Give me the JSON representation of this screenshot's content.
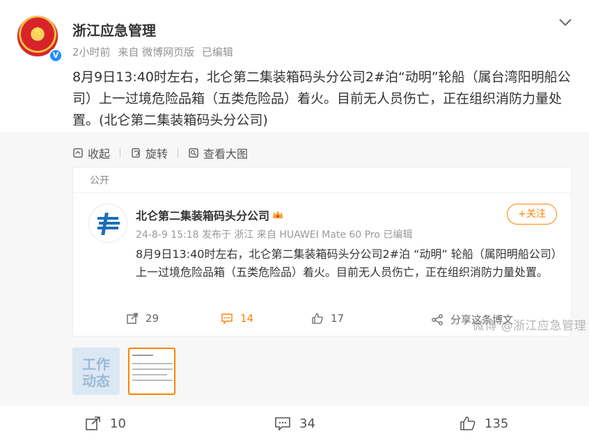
{
  "post": {
    "author": "浙江应急管理",
    "time": "2小时前",
    "source": "来自 微博网页版",
    "edited": "已编辑",
    "text": "8月9日13:40时左右，北仑第二集装箱码头分公司2#泊“动明”轮船（属台湾阳明船公司）上一过境危险品箱（五类危险品）着火。目前无人员伤亡，正在组织消防力量处置。(北仑第二集装箱码头分公司)",
    "verified_badge": "V"
  },
  "toolbar": {
    "collapse_label": "收起",
    "rotate_label": "旋转",
    "view_large_label": "查看大图"
  },
  "repost": {
    "visibility": "公开",
    "author": "北仑第二集装箱码头分公司",
    "meta": "24-8-9 15:18  发布于 浙江  来自 HUAWEI Mate 60 Pro 已编辑",
    "follow_label": "+关注",
    "text": "8月9日13:40时左右，北仑第二集装箱码头分公司2#泊 “动明” 轮船（属阳明船公司）上一过境危险品箱（五类危险品）着火。目前无人员伤亡，正在组织消防力量处置。",
    "reposts": "29",
    "comments": "14",
    "likes": "17",
    "share_label": "分享这条博文"
  },
  "watermark": "微博 @浙江应急管理",
  "thumbnails": {
    "thumb1_text": "工作动态"
  },
  "bottom": {
    "reposts": "10",
    "comments": "34",
    "likes": "135"
  },
  "colors": {
    "accent": "#ff8200",
    "verified": "#1e90ff"
  }
}
